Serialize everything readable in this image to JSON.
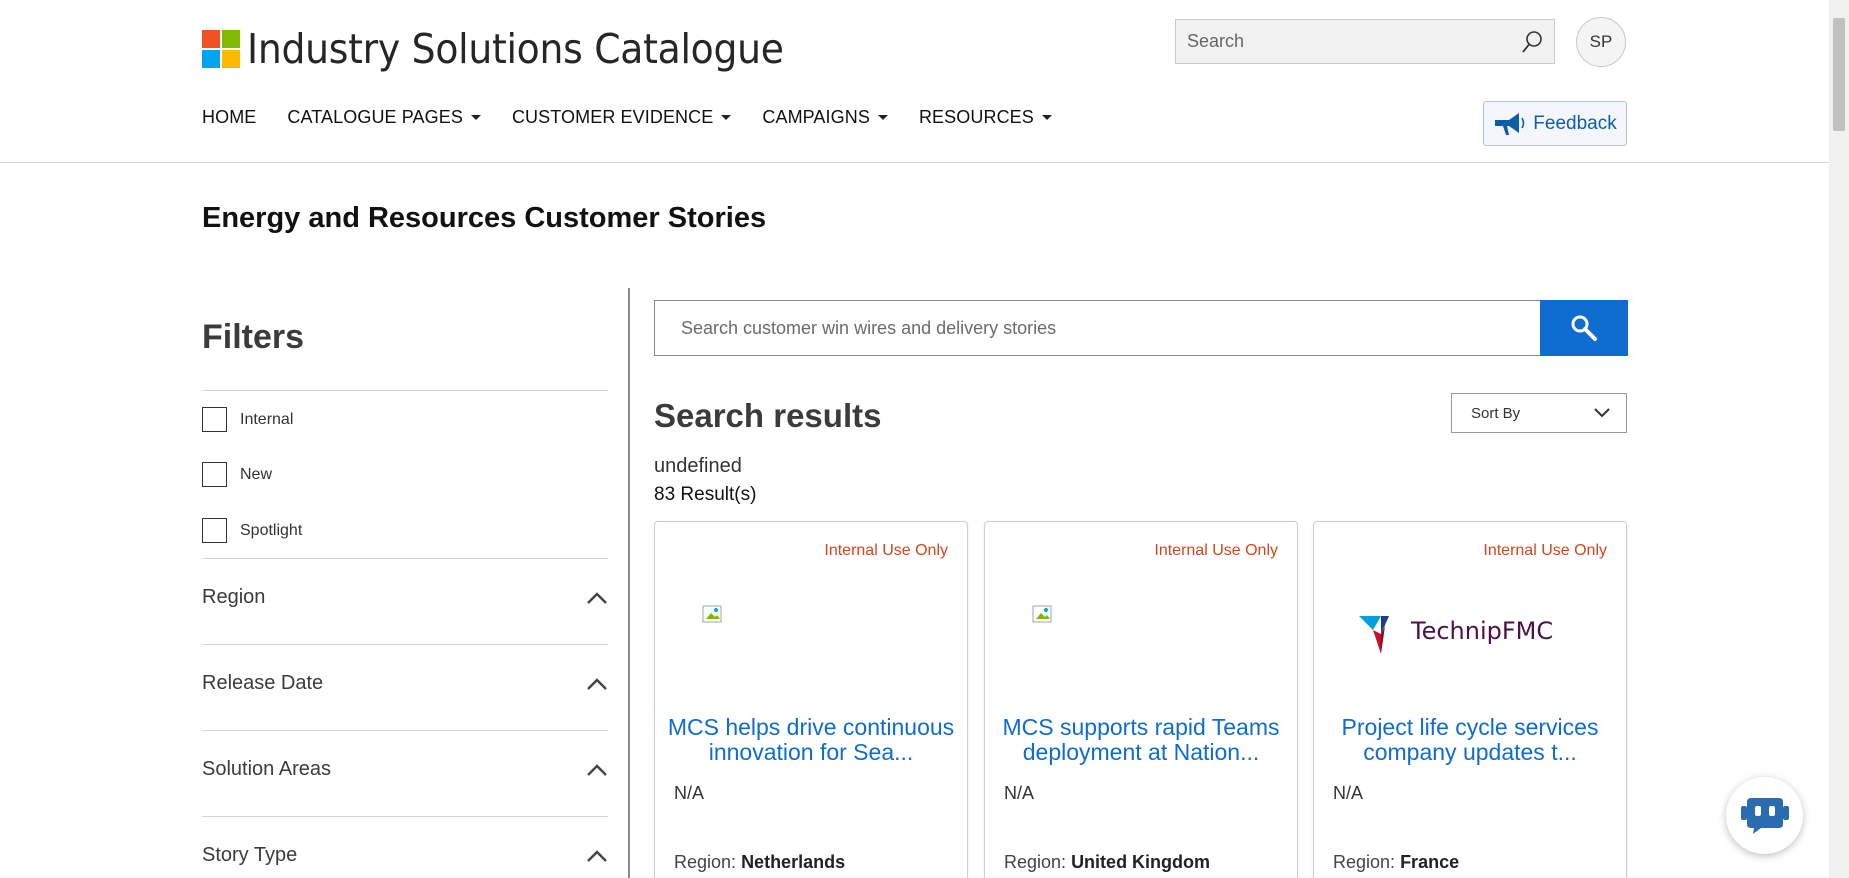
{
  "app": {
    "title": "Industry Solutions Catalogue",
    "logo_colors": [
      "#f25022",
      "#7fba00",
      "#00a4ef",
      "#ffb900"
    ]
  },
  "header": {
    "search_placeholder": "Search",
    "avatar_initials": "SP",
    "feedback_label": "Feedback"
  },
  "nav": {
    "items": [
      {
        "label": "HOME",
        "has_dropdown": false
      },
      {
        "label": "CATALOGUE PAGES",
        "has_dropdown": true
      },
      {
        "label": "CUSTOMER EVIDENCE",
        "has_dropdown": true
      },
      {
        "label": "CAMPAIGNS",
        "has_dropdown": true
      },
      {
        "label": "RESOURCES",
        "has_dropdown": true
      }
    ]
  },
  "page": {
    "title": "Energy and Resources Customer Stories"
  },
  "filters": {
    "title": "Filters",
    "checkboxes": [
      {
        "label": "Internal",
        "checked": false
      },
      {
        "label": "New",
        "checked": false
      },
      {
        "label": "Spotlight",
        "checked": false
      }
    ],
    "sections": [
      {
        "label": "Region",
        "icon": "chevron-up-icon"
      },
      {
        "label": "Release Date",
        "icon": "chevron-up-icon"
      },
      {
        "label": "Solution Areas",
        "icon": "chevron-up-icon"
      },
      {
        "label": "Story Type",
        "icon": "chevron-up-icon"
      }
    ]
  },
  "results": {
    "search_placeholder": "Search customer win wires and delivery stories",
    "title": "Search results",
    "sort_label": "Sort By",
    "query_text": "undefined",
    "count_text": "83 Result(s)",
    "accent_color": "#0f6cd1",
    "badge_color": "#d6451d",
    "cards": [
      {
        "badge": "Internal Use Only",
        "image": "broken-image-icon",
        "title_line1": "MCS helps drive continuous",
        "title_line2": "innovation for Sea...",
        "na": "N/A",
        "region_label": "Region:",
        "region_value": "Netherlands"
      },
      {
        "badge": "Internal Use Only",
        "image": "broken-image-icon",
        "title_line1": "MCS supports rapid Teams",
        "title_line2": "deployment at Nation...",
        "na": "N/A",
        "region_label": "Region:",
        "region_value": "United Kingdom"
      },
      {
        "badge": "Internal Use Only",
        "image": "technipfmc-logo",
        "logo_text": "TechnipFMC",
        "title_line1": "Project life cycle services",
        "title_line2": "company updates t...",
        "na": "N/A",
        "region_label": "Region:",
        "region_value": "France"
      }
    ]
  }
}
